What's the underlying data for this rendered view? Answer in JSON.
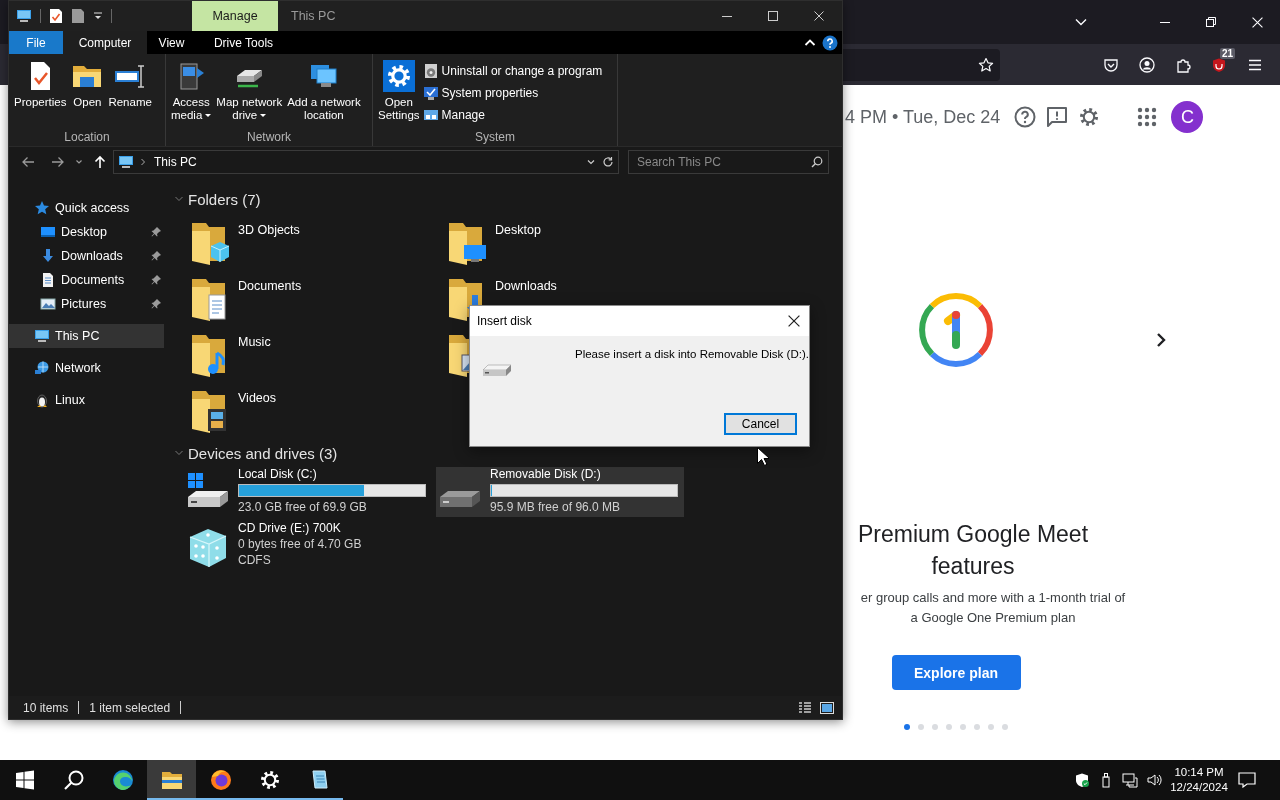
{
  "browser": {
    "extension_badge": "21",
    "header": {
      "date_time": "4 PM • Tue, Dec 24",
      "avatar_letter": "C"
    },
    "promo": {
      "title_lines": [
        "Premium Google Meet",
        "features"
      ],
      "body_lines": [
        "er group calls and more with a 1-month trial of",
        "a Google One Premium plan"
      ],
      "button": "Explore plan",
      "dots": [
        {
          "selected": true
        },
        {
          "selected": false
        },
        {
          "selected": false
        },
        {
          "selected": false
        },
        {
          "selected": false
        },
        {
          "selected": false
        },
        {
          "selected": false
        },
        {
          "selected": false
        }
      ]
    }
  },
  "explorer": {
    "context_tab": "Manage",
    "title": "This PC",
    "ribbon_tabs": [
      {
        "kind": "file",
        "label": "File",
        "selected": false
      },
      {
        "kind": "tab",
        "label": "Computer",
        "selected": true
      },
      {
        "kind": "tab",
        "label": "View",
        "selected": false
      },
      {
        "kind": "tab",
        "label": "Drive Tools",
        "selected": false
      }
    ],
    "ribbon_groups": [
      {
        "label": "Location",
        "commands": [
          {
            "kind": "large",
            "label": "Properties",
            "dropdown": false
          },
          {
            "kind": "large",
            "label": "Open",
            "dropdown": false
          },
          {
            "kind": "large",
            "label": "Rename",
            "dropdown": false
          }
        ]
      },
      {
        "label": "Network",
        "commands": [
          {
            "kind": "large",
            "label": "Access\nmedia",
            "dropdown": true
          },
          {
            "kind": "large",
            "label": "Map network\ndrive",
            "dropdown": true
          },
          {
            "kind": "large",
            "label": "Add a network\nlocation",
            "dropdown": false
          }
        ]
      },
      {
        "label": "System",
        "commands": [
          {
            "kind": "large",
            "label": "Open\nSettings",
            "dropdown": false
          },
          {
            "kind": "small",
            "label": "Uninstall or change a program",
            "dropdown": false
          },
          {
            "kind": "small",
            "label": "System properties",
            "dropdown": false
          },
          {
            "kind": "small",
            "label": "Manage",
            "dropdown": false
          }
        ]
      }
    ],
    "address": {
      "path": "This PC"
    },
    "search": {
      "placeholder": "Search This PC"
    },
    "nav": [
      {
        "label": "Quick access",
        "selected": false,
        "children": [
          {
            "label": "Desktop",
            "pinned": true,
            "selected": false
          },
          {
            "label": "Downloads",
            "pinned": true,
            "selected": false
          },
          {
            "label": "Documents",
            "pinned": true,
            "selected": false
          },
          {
            "label": "Pictures",
            "pinned": true,
            "selected": false
          }
        ]
      },
      {
        "label": "This PC",
        "selected": true
      },
      {
        "label": "Network",
        "selected": false
      },
      {
        "label": "Linux",
        "selected": false
      }
    ],
    "folders": {
      "title": "Folders (7)",
      "expanded": true,
      "items": [
        {
          "kind": "folder",
          "label": "3D Objects"
        },
        {
          "kind": "folder",
          "label": "Desktop"
        },
        {
          "kind": "folder",
          "label": "Documents"
        },
        {
          "kind": "folder",
          "label": "Downloads"
        },
        {
          "kind": "folder",
          "label": "Music"
        },
        {
          "kind": "folder-partial"
        },
        {
          "kind": "folder",
          "label": "Videos"
        }
      ]
    },
    "drives": {
      "title": "Devices and drives (3)",
      "expanded": true,
      "items": [
        {
          "kind": "bar",
          "name": "Local Disk (C:)",
          "level": 0.67,
          "free": "23.0 GB free of 69.9 GB",
          "selected": false
        },
        {
          "kind": "bar",
          "name": "Removable Disk (D:)",
          "level": 0.001,
          "free": "95.9 MB free of 96.0 MB",
          "selected": true
        },
        {
          "kind": "info",
          "name": "CD Drive (E:) 700K",
          "lines": [
            "0 bytes free of 4.70 GB",
            "CDFS"
          ],
          "selected": false
        }
      ]
    },
    "status_bar": {
      "item_count": "10 items",
      "selection": "1 item selected"
    }
  },
  "dialog": {
    "title": "Insert disk",
    "message": "Please insert a disk into Removable Disk (D:).",
    "button": "Cancel"
  },
  "taskbar": {
    "apps": [
      {
        "running": false,
        "active": false
      },
      {
        "running": true,
        "active": true
      },
      {
        "running": true,
        "active": false
      },
      {
        "running": true,
        "active": false
      },
      {
        "running": true,
        "active": false
      }
    ],
    "time": "10:14 PM",
    "date": "12/24/2024"
  }
}
